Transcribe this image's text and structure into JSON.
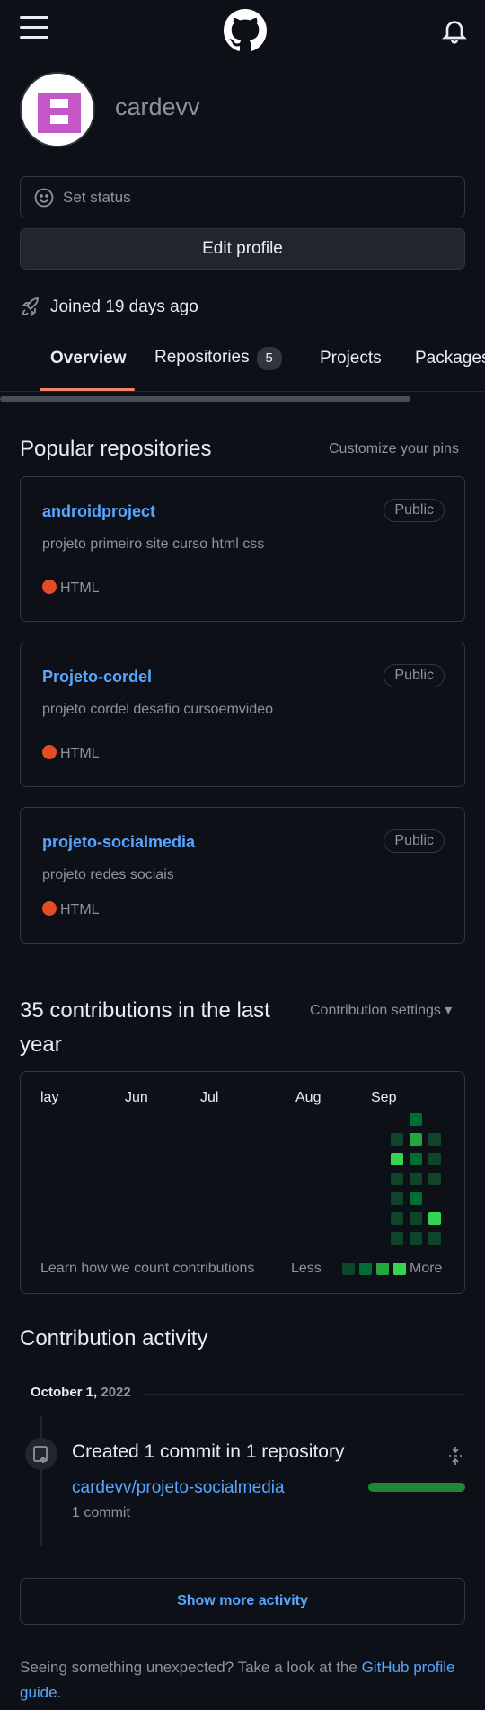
{
  "header": {
    "menu_icon": "hamburger-icon",
    "logo_icon": "github-octocat-icon",
    "notification_icon": "bell-icon"
  },
  "profile": {
    "username": "cardevv",
    "status_placeholder": "Set status",
    "edit_button": "Edit profile",
    "joined": "Joined 19 days ago"
  },
  "tabs": [
    {
      "label": "Overview",
      "active": true
    },
    {
      "label": "Repositories",
      "count": "5"
    },
    {
      "label": "Projects"
    },
    {
      "label": "Packages"
    }
  ],
  "popular": {
    "title": "Popular repositories",
    "customize_link": "Customize your pins",
    "repos": [
      {
        "name": "androidproject",
        "visibility": "Public",
        "description": "projeto primeiro site curso html css",
        "language": "HTML"
      },
      {
        "name": "Projeto-cordel",
        "visibility": "Public",
        "description": "projeto cordel desafio cursoemvideo",
        "language": "HTML"
      },
      {
        "name": "projeto-socialmedia",
        "visibility": "Public",
        "description": "projeto redes sociais",
        "language": "HTML"
      }
    ],
    "language_color": "#e34c26"
  },
  "contributions": {
    "title": "35 contributions in the last year",
    "settings_link": "Contribution settings ▾",
    "months": [
      "lay",
      "Jun",
      "Jul",
      "Aug",
      "Sep"
    ],
    "learn_link": "Learn how we count contributions",
    "less_label": "Less",
    "more_label": "More",
    "level_colors": [
      "#0e4429",
      "#006d32",
      "#26a641",
      "#39d353"
    ]
  },
  "activity": {
    "title": "Contribution activity",
    "date_day": "October 1,",
    "date_year": "2022",
    "event_text": "Created 1 commit in 1 repository",
    "repo_link": "cardevv/projeto-socialmedia",
    "commit_count": "1 commit",
    "show_more": "Show more activity"
  },
  "footer": {
    "text": "Seeing something unexpected? Take a look at the ",
    "link": "GitHub profile guide",
    "end": "."
  }
}
